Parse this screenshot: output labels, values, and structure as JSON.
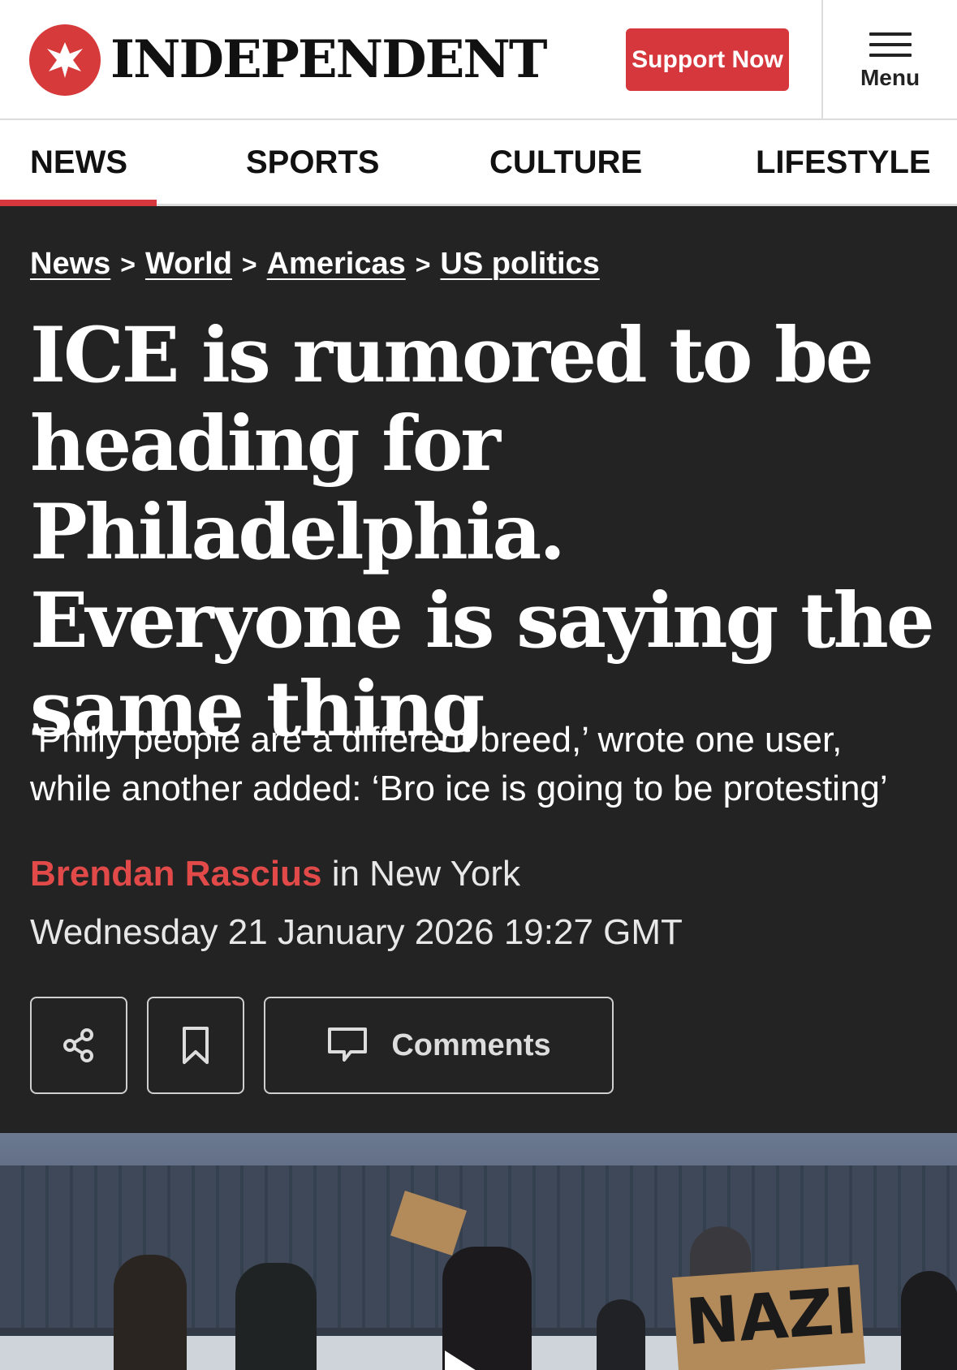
{
  "header": {
    "brand": "INDEPENDENT",
    "support_label": "Support Now",
    "menu_label": "Menu",
    "logo_icon": "eagle-icon",
    "accent_color": "#d5373d"
  },
  "nav": {
    "tabs": [
      {
        "label": "NEWS",
        "active": true
      },
      {
        "label": "SPORTS",
        "active": false
      },
      {
        "label": "CULTURE",
        "active": false
      },
      {
        "label": "LIFESTYLE",
        "active": false
      }
    ]
  },
  "breadcrumb": {
    "items": [
      "News",
      "World",
      "Americas",
      "US politics"
    ],
    "separator": ">"
  },
  "article": {
    "headline": "ICE is rumored to be heading for Philadelphia. Everyone is saying the same thing",
    "standfirst": "‘Philly people are a different breed,’ wrote one user, while another added: ‘Bro ice is going to be protesting’",
    "author": "Brendan Rascius",
    "location": "in New York",
    "date": "Wednesday 21 January 2026 19:27 GMT",
    "actions": {
      "share_icon": "share-icon",
      "bookmark_icon": "bookmark-icon",
      "comments_icon": "comment-icon",
      "comments_label": "Comments"
    }
  },
  "hero": {
    "sign_text": "NAZI",
    "play_icon": "play-icon"
  }
}
